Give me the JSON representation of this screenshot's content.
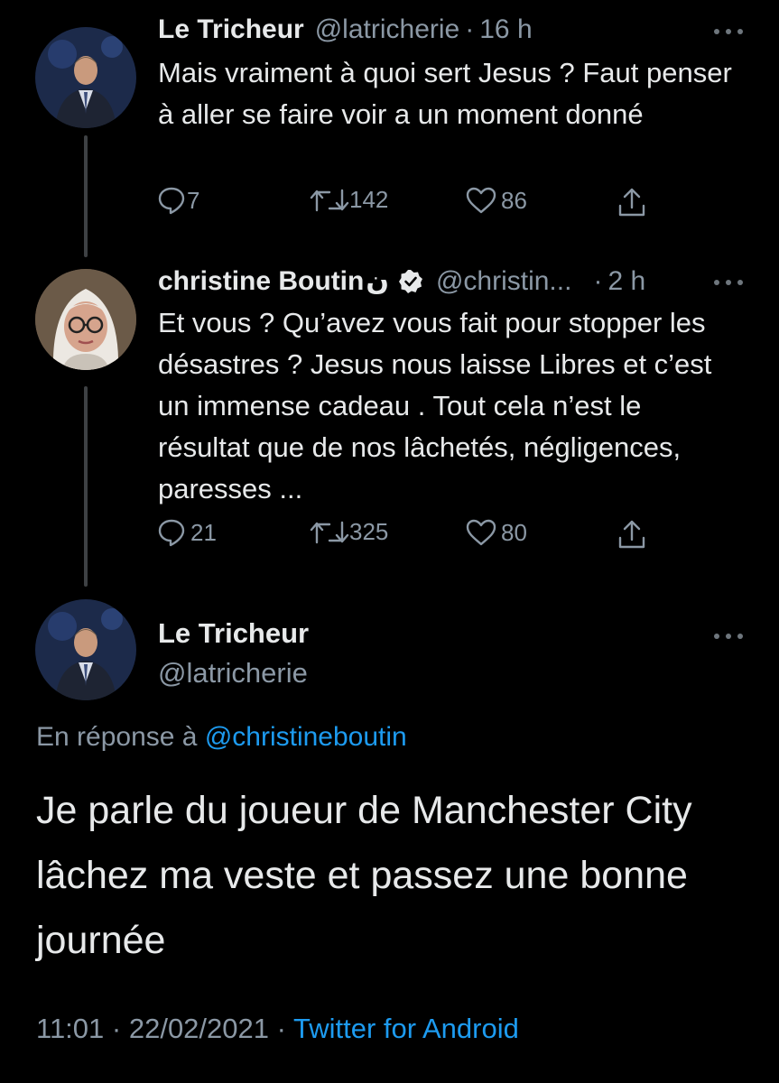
{
  "tweet1": {
    "name": "Le Tricheur",
    "handle": "@latricherie",
    "time": "16 h",
    "text": "Mais vraiment à quoi sert Jesus ? Faut penser à aller se faire voir a un moment donné",
    "replies": "7",
    "retweets": "142",
    "likes": "86"
  },
  "tweet2": {
    "name": "christine Boutin",
    "name_suffix": "ن",
    "handle": "@christin...",
    "time": "2 h",
    "text": "Et vous ? Qu’avez vous fait pour stopper les désastres ? Jesus nous laisse Libres et c’est un immense cadeau . Tout cela n’est le résultat que de nos lâchetés, négligences, paresses ...",
    "replies": "21",
    "retweets": "325",
    "likes": "80"
  },
  "main_tweet": {
    "name": "Le Tricheur",
    "handle": "@latricherie",
    "reply_prefix": "En réponse à",
    "reply_mention": "@christineboutin",
    "text": "Je parle du joueur de Manchester City lâchez ma veste et passez une bonne journée",
    "time": "11:01",
    "date": "22/02/2021",
    "client": "Twitter for Android"
  },
  "colors": {
    "background": "#000000",
    "text": "#e7e9ea",
    "secondary": "#8b98a5",
    "link": "#1d9bf0"
  },
  "icons": [
    "reply-icon",
    "retweet-icon",
    "like-icon",
    "share-icon",
    "more-icon",
    "verified-badge-icon"
  ]
}
